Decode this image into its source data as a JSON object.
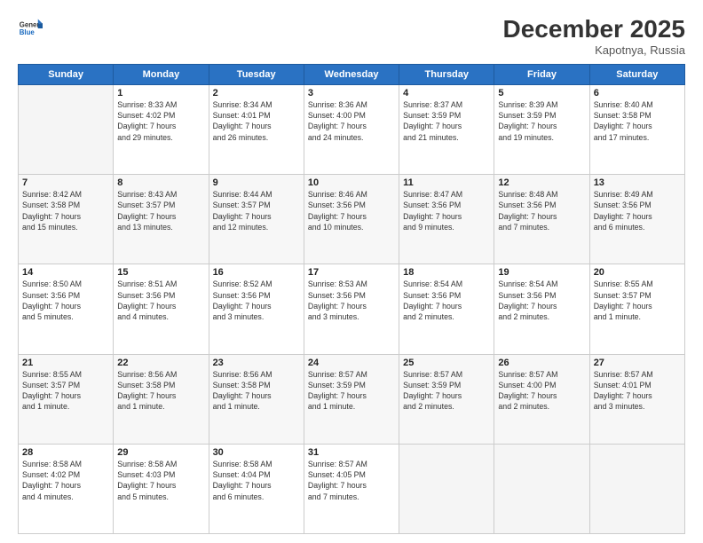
{
  "header": {
    "logo": {
      "general": "General",
      "blue": "Blue"
    },
    "month": "December 2025",
    "location": "Kapotnya, Russia"
  },
  "weekdays": [
    "Sunday",
    "Monday",
    "Tuesday",
    "Wednesday",
    "Thursday",
    "Friday",
    "Saturday"
  ],
  "weeks": [
    [
      {
        "day": "",
        "info": ""
      },
      {
        "day": "1",
        "info": "Sunrise: 8:33 AM\nSunset: 4:02 PM\nDaylight: 7 hours\nand 29 minutes."
      },
      {
        "day": "2",
        "info": "Sunrise: 8:34 AM\nSunset: 4:01 PM\nDaylight: 7 hours\nand 26 minutes."
      },
      {
        "day": "3",
        "info": "Sunrise: 8:36 AM\nSunset: 4:00 PM\nDaylight: 7 hours\nand 24 minutes."
      },
      {
        "day": "4",
        "info": "Sunrise: 8:37 AM\nSunset: 3:59 PM\nDaylight: 7 hours\nand 21 minutes."
      },
      {
        "day": "5",
        "info": "Sunrise: 8:39 AM\nSunset: 3:59 PM\nDaylight: 7 hours\nand 19 minutes."
      },
      {
        "day": "6",
        "info": "Sunrise: 8:40 AM\nSunset: 3:58 PM\nDaylight: 7 hours\nand 17 minutes."
      }
    ],
    [
      {
        "day": "7",
        "info": "Sunrise: 8:42 AM\nSunset: 3:58 PM\nDaylight: 7 hours\nand 15 minutes."
      },
      {
        "day": "8",
        "info": "Sunrise: 8:43 AM\nSunset: 3:57 PM\nDaylight: 7 hours\nand 13 minutes."
      },
      {
        "day": "9",
        "info": "Sunrise: 8:44 AM\nSunset: 3:57 PM\nDaylight: 7 hours\nand 12 minutes."
      },
      {
        "day": "10",
        "info": "Sunrise: 8:46 AM\nSunset: 3:56 PM\nDaylight: 7 hours\nand 10 minutes."
      },
      {
        "day": "11",
        "info": "Sunrise: 8:47 AM\nSunset: 3:56 PM\nDaylight: 7 hours\nand 9 minutes."
      },
      {
        "day": "12",
        "info": "Sunrise: 8:48 AM\nSunset: 3:56 PM\nDaylight: 7 hours\nand 7 minutes."
      },
      {
        "day": "13",
        "info": "Sunrise: 8:49 AM\nSunset: 3:56 PM\nDaylight: 7 hours\nand 6 minutes."
      }
    ],
    [
      {
        "day": "14",
        "info": "Sunrise: 8:50 AM\nSunset: 3:56 PM\nDaylight: 7 hours\nand 5 minutes."
      },
      {
        "day": "15",
        "info": "Sunrise: 8:51 AM\nSunset: 3:56 PM\nDaylight: 7 hours\nand 4 minutes."
      },
      {
        "day": "16",
        "info": "Sunrise: 8:52 AM\nSunset: 3:56 PM\nDaylight: 7 hours\nand 3 minutes."
      },
      {
        "day": "17",
        "info": "Sunrise: 8:53 AM\nSunset: 3:56 PM\nDaylight: 7 hours\nand 3 minutes."
      },
      {
        "day": "18",
        "info": "Sunrise: 8:54 AM\nSunset: 3:56 PM\nDaylight: 7 hours\nand 2 minutes."
      },
      {
        "day": "19",
        "info": "Sunrise: 8:54 AM\nSunset: 3:56 PM\nDaylight: 7 hours\nand 2 minutes."
      },
      {
        "day": "20",
        "info": "Sunrise: 8:55 AM\nSunset: 3:57 PM\nDaylight: 7 hours\nand 1 minute."
      }
    ],
    [
      {
        "day": "21",
        "info": "Sunrise: 8:55 AM\nSunset: 3:57 PM\nDaylight: 7 hours\nand 1 minute."
      },
      {
        "day": "22",
        "info": "Sunrise: 8:56 AM\nSunset: 3:58 PM\nDaylight: 7 hours\nand 1 minute."
      },
      {
        "day": "23",
        "info": "Sunrise: 8:56 AM\nSunset: 3:58 PM\nDaylight: 7 hours\nand 1 minute."
      },
      {
        "day": "24",
        "info": "Sunrise: 8:57 AM\nSunset: 3:59 PM\nDaylight: 7 hours\nand 1 minute."
      },
      {
        "day": "25",
        "info": "Sunrise: 8:57 AM\nSunset: 3:59 PM\nDaylight: 7 hours\nand 2 minutes."
      },
      {
        "day": "26",
        "info": "Sunrise: 8:57 AM\nSunset: 4:00 PM\nDaylight: 7 hours\nand 2 minutes."
      },
      {
        "day": "27",
        "info": "Sunrise: 8:57 AM\nSunset: 4:01 PM\nDaylight: 7 hours\nand 3 minutes."
      }
    ],
    [
      {
        "day": "28",
        "info": "Sunrise: 8:58 AM\nSunset: 4:02 PM\nDaylight: 7 hours\nand 4 minutes."
      },
      {
        "day": "29",
        "info": "Sunrise: 8:58 AM\nSunset: 4:03 PM\nDaylight: 7 hours\nand 5 minutes."
      },
      {
        "day": "30",
        "info": "Sunrise: 8:58 AM\nSunset: 4:04 PM\nDaylight: 7 hours\nand 6 minutes."
      },
      {
        "day": "31",
        "info": "Sunrise: 8:57 AM\nSunset: 4:05 PM\nDaylight: 7 hours\nand 7 minutes."
      },
      {
        "day": "",
        "info": ""
      },
      {
        "day": "",
        "info": ""
      },
      {
        "day": "",
        "info": ""
      }
    ]
  ]
}
